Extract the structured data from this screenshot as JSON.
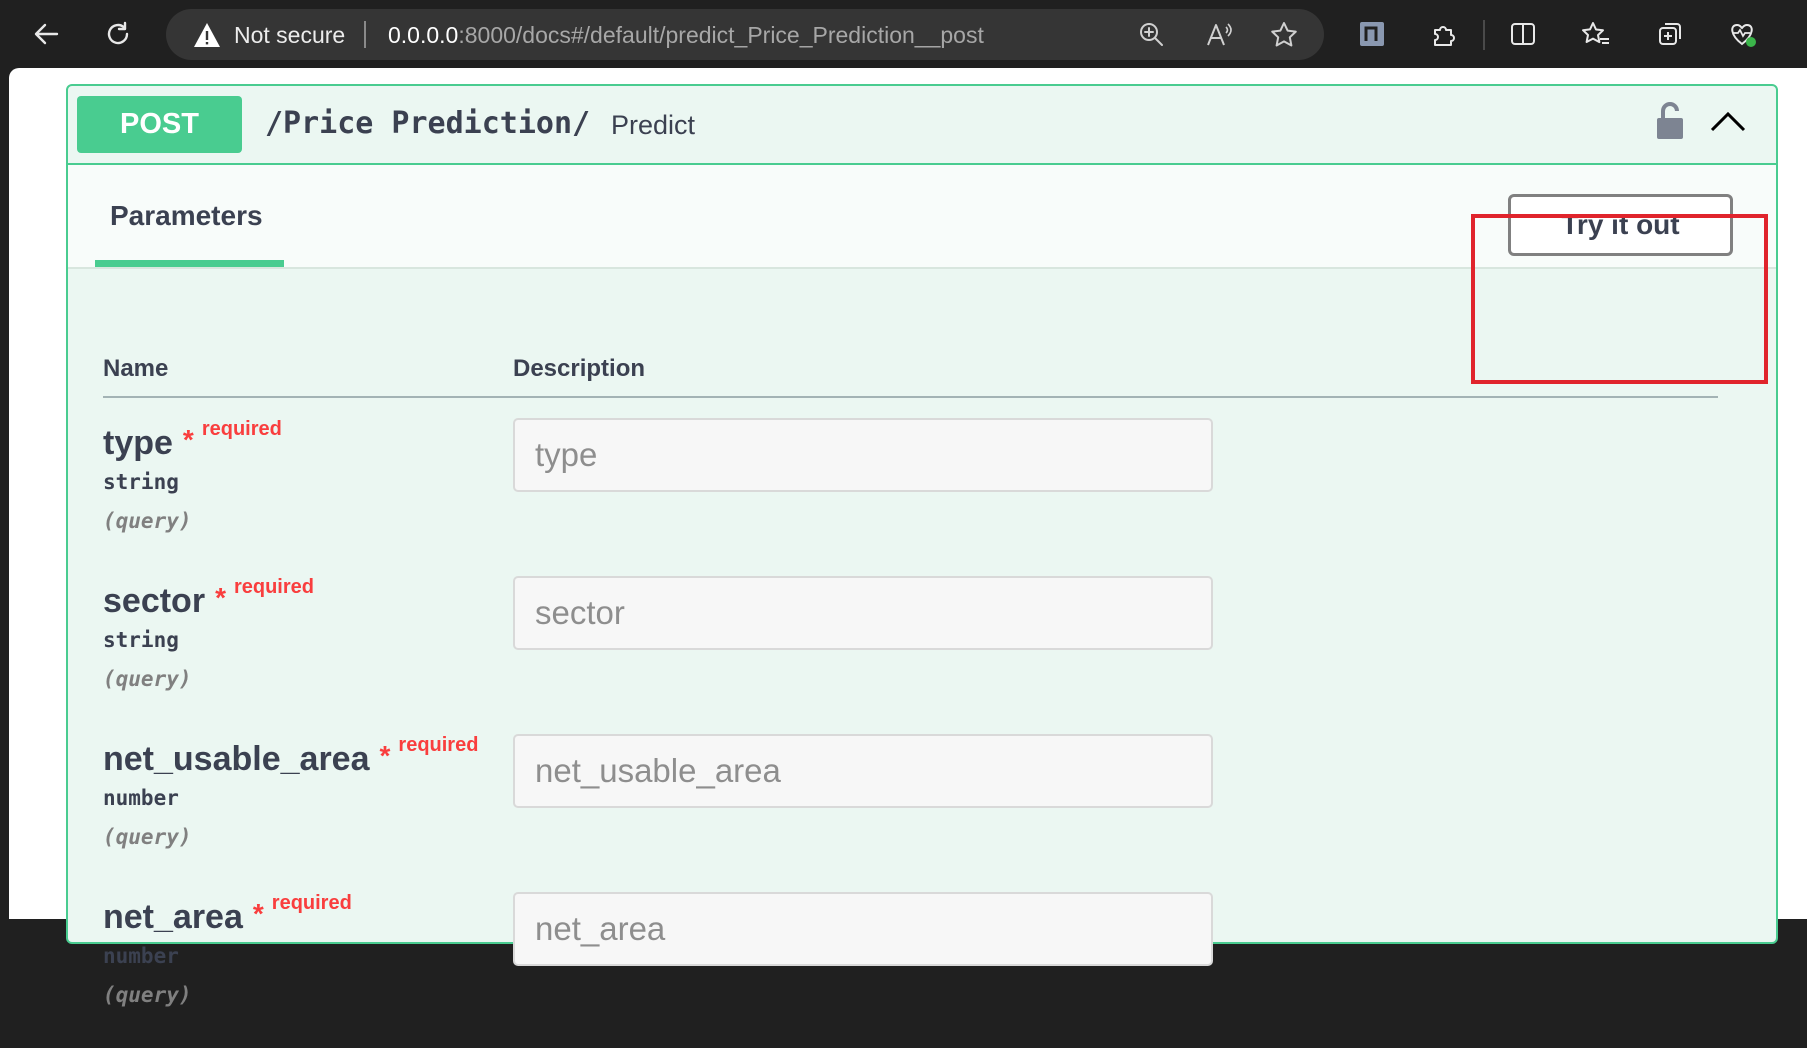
{
  "browser": {
    "security_label": "Not secure",
    "url_host": "0.0.0.0",
    "url_rest": ":8000/docs#/default/predict_Price_Prediction__post"
  },
  "operation": {
    "method": "POST",
    "path": "/Price Prediction/",
    "summary": "Predict"
  },
  "tabs": {
    "parameters": "Parameters"
  },
  "try_button": "Try it out",
  "table": {
    "name_header": "Name",
    "description_header": "Description"
  },
  "parameters": [
    {
      "name": "type",
      "required_mark": "*",
      "required_label": "required",
      "type": "string",
      "in": "(query)",
      "placeholder": "type"
    },
    {
      "name": "sector",
      "required_mark": "*",
      "required_label": "required",
      "type": "string",
      "in": "(query)",
      "placeholder": "sector"
    },
    {
      "name": "net_usable_area",
      "required_mark": "*",
      "required_label": "required",
      "type": "number",
      "in": "(query)",
      "placeholder": "net_usable_area"
    },
    {
      "name": "net_area",
      "required_mark": "*",
      "required_label": "required",
      "type": "number",
      "in": "(query)",
      "placeholder": "net_area"
    }
  ],
  "colors": {
    "post_green": "#49cc90",
    "required_red": "#f93e3e",
    "highlight_red": "#e0242c"
  }
}
